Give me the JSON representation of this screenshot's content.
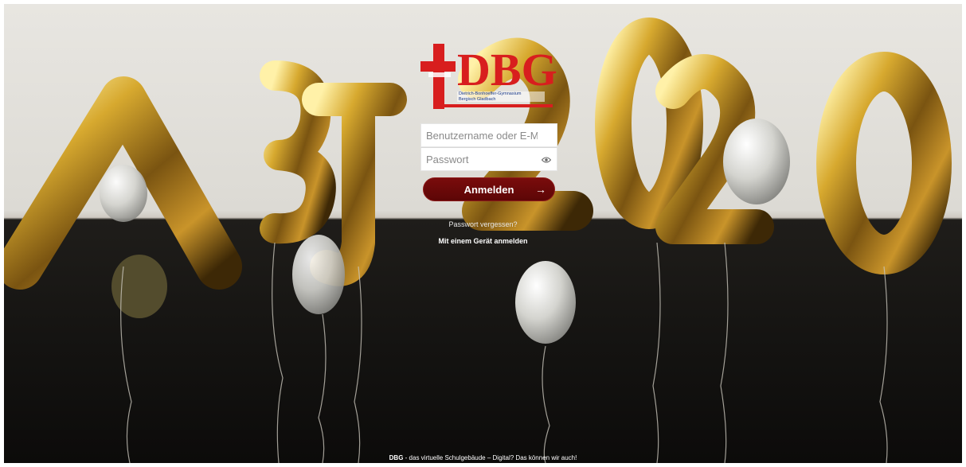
{
  "logo": {
    "brand": "DBG",
    "line1": "Dietrich-Bonhoeffer-Gymnasium",
    "line2": "Bergisch Gladbach",
    "colors": {
      "red": "#d81e1e",
      "text_blue": "#1a3a8a"
    }
  },
  "login": {
    "username_placeholder": "Benutzername oder E-Mail",
    "password_placeholder": "Passwort",
    "eye_icon": "eye-icon",
    "submit_label": "Anmelden",
    "submit_icon": "→",
    "submit_color": "#6b0909"
  },
  "links": {
    "forgot_password": "Passwort vergessen?",
    "device_login": "Mit einem Gerät anmelden"
  },
  "footer": {
    "brand": "DBG",
    "text": " - das virtuelle Schulgebäude – Digital? Das können wir auch!"
  }
}
